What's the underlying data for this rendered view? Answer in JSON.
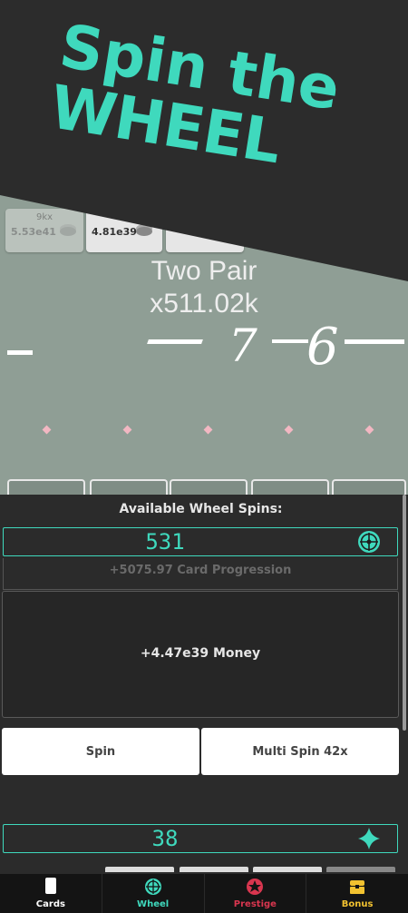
{
  "banner": {
    "line1": "Spin the",
    "line2": "WHEEL",
    "color": "#3fd9bd"
  },
  "game": {
    "chips": [
      {
        "top": "9kx",
        "value": "5.53e41"
      },
      {
        "value": "4.81e39"
      },
      {
        "value": ""
      }
    ],
    "hand_name": "Two Pair",
    "hand_multiplier": "x511.02k",
    "wheel_numbers": [
      "7",
      "6"
    ]
  },
  "panel": {
    "spins_label": "Available Wheel Spins:",
    "spins_count": "531",
    "reward_partial": "+5075.97 Card Progression",
    "reward_main": "+4.47e39 Money",
    "spin_button": "Spin",
    "multi_spin_button": "Multi Spin 42x",
    "gems_count": "38",
    "accent_color": "#3fd9bd"
  },
  "nav": {
    "items": [
      {
        "label": "Cards",
        "color": "#ffffff",
        "icon": "card-icon"
      },
      {
        "label": "Wheel",
        "color": "#3fd9bd",
        "icon": "wheel-icon"
      },
      {
        "label": "Prestige",
        "color": "#d9364f",
        "icon": "prestige-icon"
      },
      {
        "label": "Bonus",
        "color": "#f2c230",
        "icon": "chest-icon"
      }
    ]
  }
}
